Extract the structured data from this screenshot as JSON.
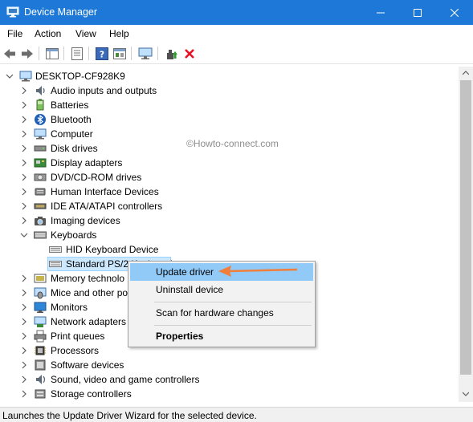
{
  "window": {
    "title": "Device Manager",
    "icon": "device-manager-icon",
    "accent": "#1e78d7"
  },
  "menu": [
    "File",
    "Action",
    "View",
    "Help"
  ],
  "toolbar": {
    "icons": [
      "back-arrow-icon",
      "forward-arrow-icon",
      "properties-pane-icon",
      "view-icon",
      "help-icon",
      "show-hidden-icon",
      "scan-monitor-icon",
      "update-driver-icon",
      "uninstall-x-icon"
    ],
    "uninstall_color": "#e81123"
  },
  "tree": {
    "root": "DESKTOP-CF928K9",
    "categories": [
      {
        "label": "Audio inputs and outputs",
        "icon": "audio-icon",
        "expanded": false
      },
      {
        "label": "Batteries",
        "icon": "battery-icon",
        "expanded": false
      },
      {
        "label": "Bluetooth",
        "icon": "bluetooth-icon",
        "expanded": false
      },
      {
        "label": "Computer",
        "icon": "computer-icon",
        "expanded": false
      },
      {
        "label": "Disk drives",
        "icon": "disk-drive-icon",
        "expanded": false
      },
      {
        "label": "Display adapters",
        "icon": "display-adapter-icon",
        "expanded": false
      },
      {
        "label": "DVD/CD-ROM drives",
        "icon": "dvd-icon",
        "expanded": false
      },
      {
        "label": "Human Interface Devices",
        "icon": "hid-icon",
        "expanded": false
      },
      {
        "label": "IDE ATA/ATAPI controllers",
        "icon": "ide-icon",
        "expanded": false
      },
      {
        "label": "Imaging devices",
        "icon": "camera-icon",
        "expanded": false
      },
      {
        "label": "Keyboards",
        "icon": "keyboard-icon",
        "expanded": true
      },
      {
        "label": "Memory technolo",
        "icon": "memory-icon",
        "expanded": false
      },
      {
        "label": "Mice and other po",
        "icon": "mouse-icon",
        "expanded": false
      },
      {
        "label": "Monitors",
        "icon": "monitor-icon",
        "expanded": false
      },
      {
        "label": "Network adapters",
        "icon": "network-icon",
        "expanded": false
      },
      {
        "label": "Print queues",
        "icon": "printer-icon",
        "expanded": false
      },
      {
        "label": "Processors",
        "icon": "processor-icon",
        "expanded": false
      },
      {
        "label": "Software devices",
        "icon": "software-icon",
        "expanded": false
      },
      {
        "label": "Sound, video and game controllers",
        "icon": "sound-icon",
        "expanded": false
      },
      {
        "label": "Storage controllers",
        "icon": "storage-icon",
        "expanded": false
      }
    ],
    "keyboard_children": [
      "HID Keyboard Device",
      "Standard PS/2 Keyboard"
    ]
  },
  "watermark": "©Howto-connect.com",
  "context_menu": {
    "items": [
      "Update driver",
      "Uninstall device",
      "Scan for hardware changes",
      "Properties"
    ],
    "highlighted": "Update driver",
    "highlight_color": "#91c9f7"
  },
  "annotation": {
    "arrow_color": "#f07f3c"
  },
  "status": "Launches the Update Driver Wizard for the selected device."
}
